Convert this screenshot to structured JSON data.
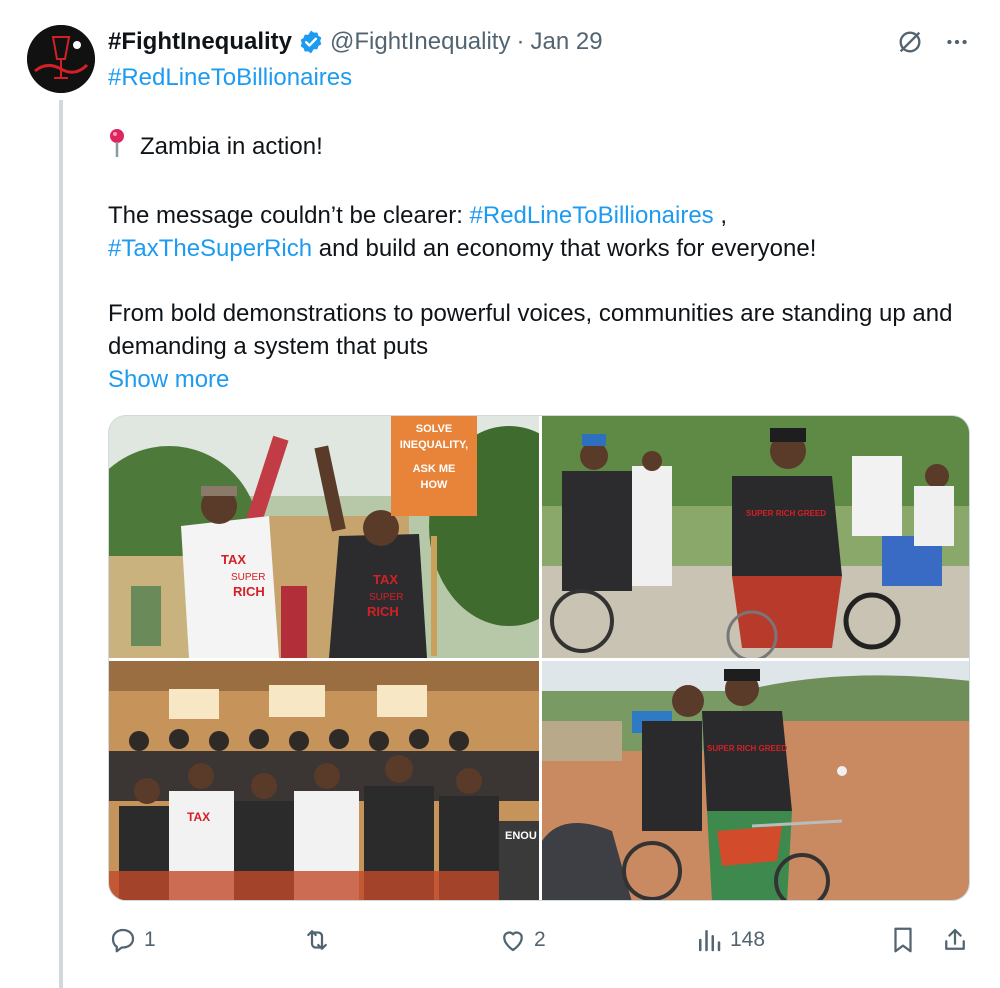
{
  "tweet": {
    "display_name": "#FightInequality",
    "handle": "@FightInequality",
    "separator": "·",
    "date": "Jan 29",
    "hashtag_line": "#RedLineToBillionaires",
    "location_line": "Zambia in action!",
    "p2_prefix": "The message couldn’t be clearer: ",
    "p2_tag1": "#RedLineToBillionaires",
    "p2_mid": " ,",
    "p2_tag2": "#TaxTheSuperRich",
    "p2_suffix": " and build an economy that works for everyone!",
    "p3": "From bold demonstrations to powerful voices, communities are standing up and demanding a system that puts",
    "show_more": "Show more"
  },
  "media": {
    "photo1": {
      "sign_line1": "SOLVE",
      "sign_line2": "INEQUALITY,",
      "sign_line3": "ASK ME",
      "sign_line4": "HOW",
      "shirt1": "TAX",
      "shirt1b": "SUPER",
      "shirt1c": "RICH",
      "shirt2": "TAX",
      "shirt2b": "SUPER",
      "shirt2c": "RICH"
    },
    "photo2": {
      "shirt": "SUPER RICH GREED"
    },
    "photo3": {
      "shirt": "TAX",
      "sign": "ENOU"
    },
    "photo4": {
      "shirt": "SUPER RICH GREED"
    }
  },
  "actions": {
    "replies": "1",
    "retweets": "",
    "likes": "2",
    "views": "148"
  },
  "colors": {
    "link": "#1d9bf0",
    "text": "#0f1419",
    "muted": "#536471",
    "border": "#cfd9de",
    "shirt_red": "#d32027"
  },
  "icons": [
    "avatar-logo",
    "verified-badge-icon",
    "grok-icon",
    "more-icon",
    "pin-icon",
    "reply-icon",
    "retweet-icon",
    "like-icon",
    "views-icon",
    "bookmark-icon",
    "share-icon"
  ]
}
